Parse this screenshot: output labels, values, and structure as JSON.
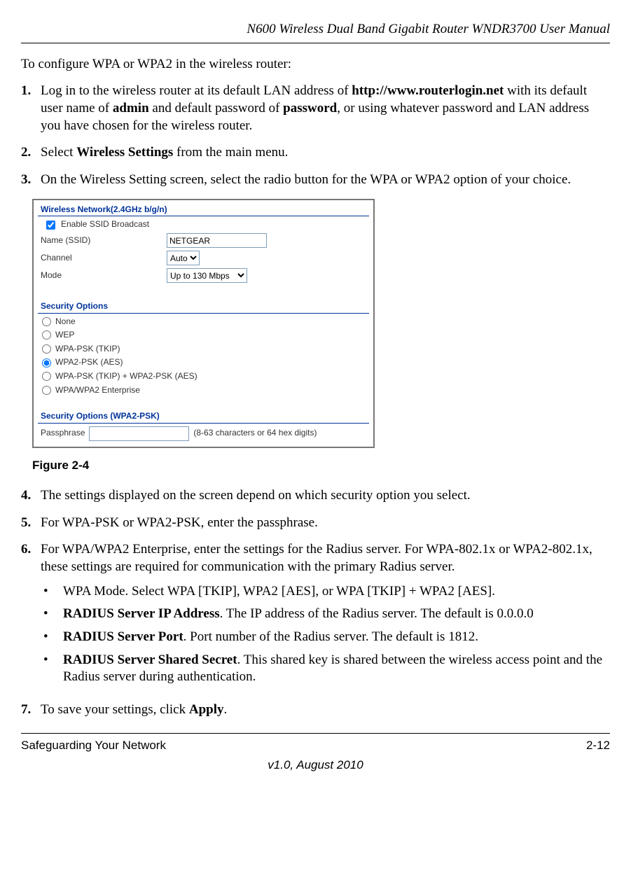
{
  "header": "N600 Wireless Dual Band Gigabit Router WNDR3700 User Manual",
  "intro": "To configure WPA or WPA2 in the wireless router:",
  "steps": {
    "s1": {
      "num": "1.",
      "pre": "Log in to the wireless router at its default LAN address of ",
      "url": "http://www.routerlogin.net",
      "mid1": " with its default user name of ",
      "admin": "admin",
      "mid2": " and default password of ",
      "pwd": "password",
      "post": ", or using whatever password and LAN address you have chosen for the wireless router."
    },
    "s2": {
      "num": "2.",
      "pre": "Select ",
      "b": "Wireless Settings",
      "post": " from the main menu."
    },
    "s3": {
      "num": "3.",
      "text": "On the Wireless Setting screen, select the radio button for the WPA or WPA2 option of your choice."
    },
    "s4": {
      "num": "4.",
      "text": "The settings displayed on the screen depend on which security option you select."
    },
    "s5": {
      "num": "5.",
      "text": "For WPA-PSK or WPA2-PSK, enter the passphrase."
    },
    "s6": {
      "num": "6.",
      "text": "For WPA/WPA2 Enterprise, enter the settings for the Radius server. For WPA-802.1x or WPA2-802.1x, these settings are required for communication with the primary Radius server.",
      "b1": "WPA Mode. Select WPA [TKIP], WPA2 [AES], or WPA [TKIP] + WPA2 [AES].",
      "b2a": "RADIUS Server IP Address",
      "b2b": ". The IP address of the Radius server. The default is 0.0.0.0",
      "b3a": "RADIUS Server Port",
      "b3b": ". Port number of the Radius server. The default is 1812.",
      "b4a": "RADIUS Server Shared Secret",
      "b4b": ". This shared key is shared between the wireless access point and the Radius server during authentication."
    },
    "s7": {
      "num": "7.",
      "pre": "To save your settings, click ",
      "b": "Apply",
      "post": "."
    }
  },
  "figcap": "Figure 2-4",
  "panel": {
    "head1": "Wireless Network(2.4GHz b/g/n)",
    "enable_ssid": "Enable SSID Broadcast",
    "name_label": "Name (SSID)",
    "name_value": "NETGEAR",
    "channel_label": "Channel",
    "channel_value": "Auto",
    "mode_label": "Mode",
    "mode_value": "Up to 130 Mbps",
    "head2": "Security Options",
    "opts": [
      "None",
      "WEP",
      "WPA-PSK (TKIP)",
      "WPA2-PSK (AES)",
      "WPA-PSK (TKIP) + WPA2-PSK (AES)",
      "WPA/WPA2 Enterprise"
    ],
    "head3": "Security Options (WPA2-PSK)",
    "pass_label": "Passphrase",
    "pass_hint": "(8-63 characters or 64 hex digits)"
  },
  "footer": {
    "left": "Safeguarding Your Network",
    "right": "2-12",
    "center": "v1.0, August 2010"
  }
}
